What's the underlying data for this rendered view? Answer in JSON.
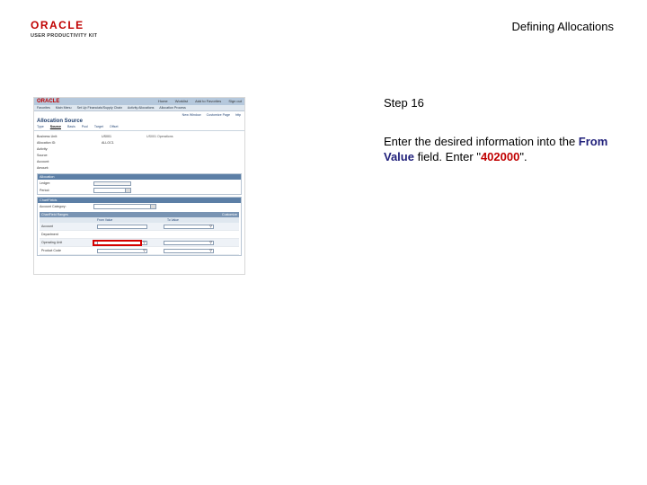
{
  "header": {
    "logo_word": "ORACLE",
    "logo_sub": "USER PRODUCTIVITY KIT",
    "doc_title": "Defining Allocations"
  },
  "screenshot": {
    "app_logo": "ORACLE",
    "top_links": [
      "Home",
      "Worklist",
      "Add to Favorites",
      "Sign out"
    ],
    "menu": [
      "Favorites",
      "Main Menu",
      "Set Up Financials/Supply Chain",
      "Activity Allocations",
      "Allocation Process"
    ],
    "toolbar": [
      "New Window",
      "Customize Page",
      "http"
    ],
    "page_title": "Allocation Source",
    "tabs": [
      "Type",
      "Source",
      "Basis",
      "Pool",
      "Target",
      "Offset"
    ],
    "fields": [
      {
        "label": "Business Unit:",
        "value": "US001",
        "desc": "US001 Operations"
      },
      {
        "label": "Allocation ID:",
        "value": "ALLOC1",
        "desc": ""
      },
      {
        "label": "Activity:",
        "value": "",
        "desc": ""
      },
      {
        "label": "Source:",
        "value": "",
        "desc": ""
      },
      {
        "label": "Account:",
        "value": "",
        "desc": ""
      },
      {
        "label": "Amount:",
        "value": "",
        "desc": ""
      }
    ],
    "allocation_panel_title": "Allocation",
    "ledger_label": "Ledger:",
    "period_label": "Period:",
    "chartfield_panel_title": "ChartFields",
    "account_category_label": "Account Category:",
    "grid_title": "ChartField Ranges",
    "grid_link": "Customize",
    "grid_columns": [
      "From Value",
      "To Value"
    ],
    "grid_rows": [
      {
        "label": "Account",
        "from": "",
        "to": ""
      },
      {
        "label": "Department",
        "from": "",
        "to": ""
      },
      {
        "label": "Operating Unit",
        "from": "",
        "to": ""
      },
      {
        "label": "Product Code",
        "from": "",
        "to": ""
      }
    ]
  },
  "instructions": {
    "step": "Step 16",
    "text_before": "Enter the desired information into the ",
    "field_name": "From Value",
    "text_middle": " field. Enter \"",
    "value": "402000",
    "text_after": "\"."
  },
  "colors": {
    "brand_red": "#c00000",
    "highlight_red": "#d40000",
    "header_blue": "#5c7fa6"
  }
}
